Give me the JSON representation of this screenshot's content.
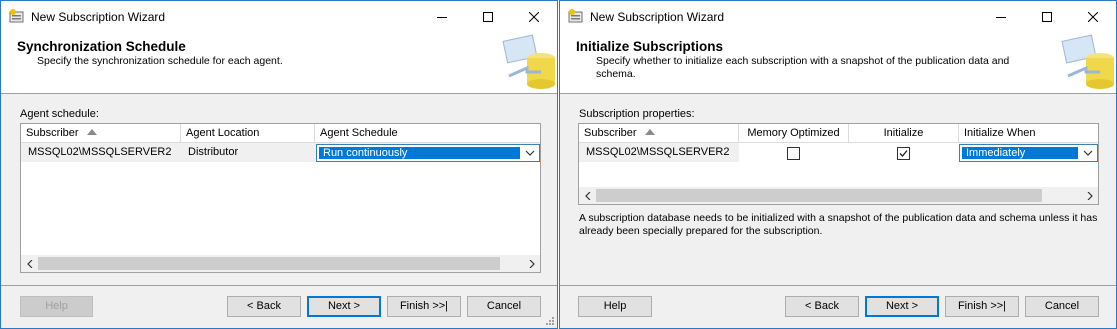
{
  "win1": {
    "title": "New Subscription Wizard",
    "header_title": "Synchronization Schedule",
    "header_desc": "Specify the synchronization schedule for each agent.",
    "section_label": "Agent schedule:",
    "columns": [
      "Subscriber",
      "Agent Location",
      "Agent Schedule"
    ],
    "row": {
      "subscriber": "MSSQL02\\MSSQLSERVER2",
      "agent_location": "Distributor",
      "agent_schedule": "Run continuously"
    },
    "buttons": {
      "help": "Help",
      "back": "< Back",
      "next": "Next >",
      "finish": "Finish >>|",
      "cancel": "Cancel"
    }
  },
  "win2": {
    "title": "New Subscription Wizard",
    "header_title": "Initialize Subscriptions",
    "header_desc": "Specify whether to initialize each subscription with a snapshot of the publication data and schema.",
    "section_label": "Subscription properties:",
    "columns": [
      "Subscriber",
      "Memory Optimized",
      "Initialize",
      "Initialize When"
    ],
    "row": {
      "subscriber": "MSSQL02\\MSSQLSERVER2",
      "memory_optimized": false,
      "initialize": true,
      "initialize_when": "Immediately"
    },
    "info_text": "A subscription database needs to be initialized with a snapshot of the publication data and schema unless it has already been specially prepared for the subscription.",
    "buttons": {
      "help": "Help",
      "back": "< Back",
      "next": "Next >",
      "finish": "Finish >>|",
      "cancel": "Cancel"
    }
  },
  "colors": {
    "accent": "#0078d7",
    "window_border": "#2b78c5",
    "dialog_bg": "#f0f0f0"
  }
}
